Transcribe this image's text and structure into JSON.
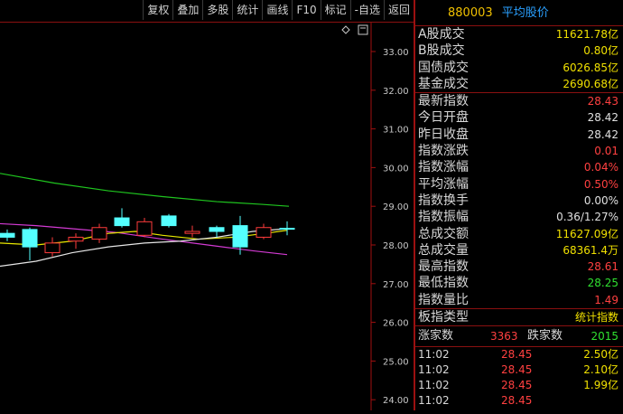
{
  "toolbar": {
    "buttons": [
      "复权",
      "叠加",
      "多股",
      "统计",
      "画线",
      "F10",
      "标记",
      "-自选",
      "返回"
    ]
  },
  "chart": {
    "y_labels": [
      "33.00",
      "32.00",
      "31.00",
      "30.00",
      "29.00",
      "28.00",
      "27.00",
      "26.00",
      "25.00",
      "24.00"
    ],
    "diamond_icon": "diamond-icon",
    "colors": {
      "ma_green": "#1fc51f",
      "ma_magenta": "#d23ad2",
      "ma_yellow": "#e8e800",
      "ma_white": "#e6e6e6",
      "up_candle": "#ff3b3b",
      "down_candle": "#54ffff"
    }
  },
  "panel": {
    "code": "880003",
    "name": "平均股价",
    "rows": [
      {
        "label": "A股成交",
        "value": "11621.78亿",
        "color": "yellow"
      },
      {
        "label": "B股成交",
        "value": "0.80亿",
        "color": "yellow"
      },
      {
        "label": "国债成交",
        "value": "6026.85亿",
        "color": "yellow"
      },
      {
        "label": "基金成交",
        "value": "2690.68亿",
        "color": "yellow"
      },
      {
        "label": "最新指数",
        "value": "28.43",
        "color": "red"
      },
      {
        "label": "今日开盘",
        "value": "28.42",
        "color": "white"
      },
      {
        "label": "昨日收盘",
        "value": "28.42",
        "color": "white"
      },
      {
        "label": "指数涨跌",
        "value": "0.01",
        "color": "red"
      },
      {
        "label": "指数涨幅",
        "value": "0.04%",
        "color": "red"
      },
      {
        "label": "平均涨幅",
        "value": "0.50%",
        "color": "red"
      },
      {
        "label": "指数换手",
        "value": "0.00%",
        "color": "white"
      },
      {
        "label": "指数振幅",
        "value": "0.36/1.27%",
        "color": "white"
      },
      {
        "label": "总成交额",
        "value": "11627.09亿",
        "color": "yellow"
      },
      {
        "label": "总成交量",
        "value": "68361.4万",
        "color": "yellow"
      },
      {
        "label": "最高指数",
        "value": "28.61",
        "color": "red"
      },
      {
        "label": "最低指数",
        "value": "28.25",
        "color": "green"
      },
      {
        "label": "指数量比",
        "value": "1.49",
        "color": "red"
      },
      {
        "label": "板指类型",
        "value": "统计指数",
        "color": "yellow"
      }
    ],
    "up_label": "涨家数",
    "up_value": "3363",
    "down_label": "跌家数",
    "down_value": "2015",
    "trades": [
      {
        "time": "11:02",
        "price": "28.45",
        "amount": "2.50亿"
      },
      {
        "time": "11:02",
        "price": "28.45",
        "amount": "2.10亿"
      },
      {
        "time": "11:02",
        "price": "28.45",
        "amount": "1.99亿"
      },
      {
        "time": "11:02",
        "price": "28.45",
        "amount": ""
      }
    ]
  }
}
